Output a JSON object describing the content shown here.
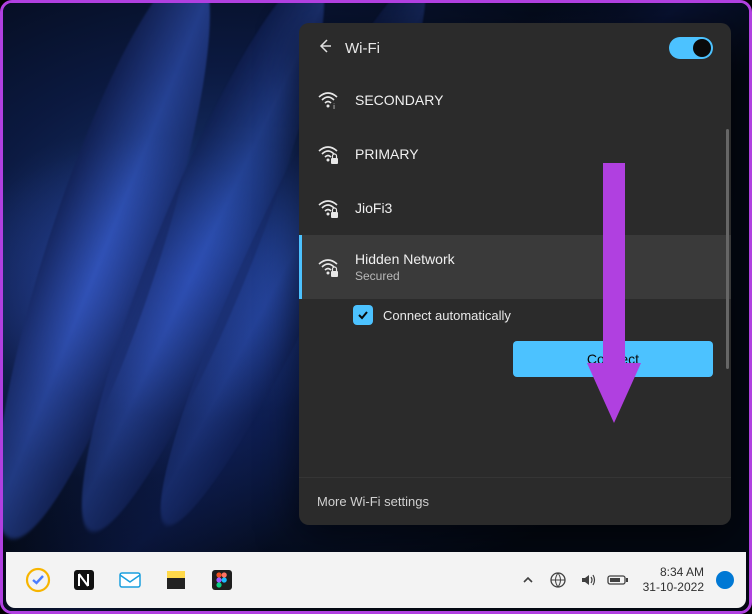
{
  "panel": {
    "title": "Wi-Fi",
    "toggle_on": true,
    "networks": [
      {
        "name": "SECONDARY",
        "secured": false,
        "selected": false
      },
      {
        "name": "PRIMARY",
        "secured": true,
        "selected": false
      },
      {
        "name": "JioFi3",
        "secured": true,
        "selected": false
      },
      {
        "name": "Hidden Network",
        "secured": true,
        "selected": true,
        "status": "Secured"
      }
    ],
    "auto_connect_label": "Connect automatically",
    "auto_connect_checked": true,
    "connect_button": "Connect",
    "more_link": "More Wi-Fi settings"
  },
  "taskbar": {
    "time": "8:34 AM",
    "date": "31-10-2022"
  },
  "colors": {
    "accent": "#4cc2ff",
    "panel_bg": "#2b2b2b",
    "annotation": "#b040e0"
  }
}
